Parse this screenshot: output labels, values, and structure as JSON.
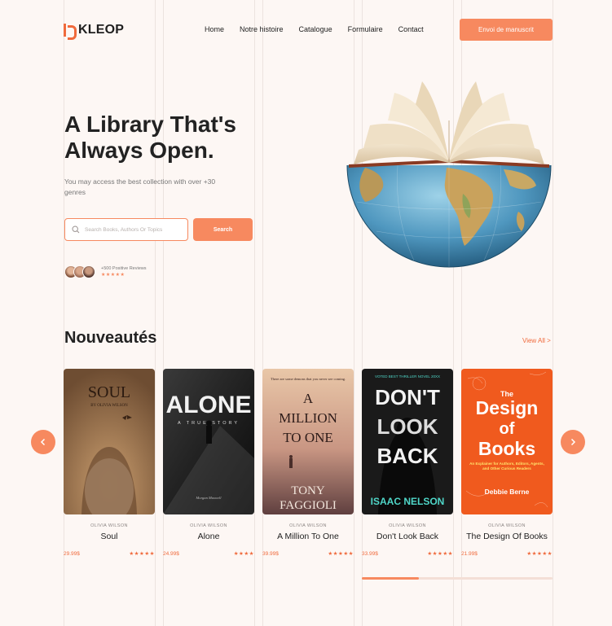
{
  "brand": {
    "name": "KLEOP"
  },
  "nav": {
    "items": [
      "Home",
      "Notre histoire",
      "Catalogue",
      "Formulaire",
      "Contact"
    ]
  },
  "cta": {
    "label": "Envoi de manuscrit"
  },
  "hero": {
    "title": "A Library That's Always Open.",
    "subtitle": "You may access the best collection with over +30 genres",
    "search": {
      "placeholder": "Search Books, Authors Or Topics",
      "button": "Search"
    },
    "reviews": {
      "label": "+500 Positive Reviews",
      "stars": "★★★★★"
    }
  },
  "section": {
    "title": "Nouveautés",
    "view_all": "View All  >"
  },
  "books": [
    {
      "author": "OLIVIA WILSON",
      "title": "Soul",
      "price": "29.99$",
      "stars": "★★★★★",
      "cover": {
        "line1": "SOUL",
        "line2": "BY OLIVIA WILSON"
      }
    },
    {
      "author": "OLIVIA WILSON",
      "title": "Alone",
      "price": "24.99$",
      "stars": "★★★★",
      "cover": {
        "line1": "ALONE",
        "line2": "A TRUE STORY",
        "line3": "Morgan Maxwell"
      }
    },
    {
      "author": "OLIVIA WILSON",
      "title": "A Million To One",
      "price": "39.99$",
      "stars": "★★★★★",
      "cover": {
        "tagline": "There are some demons that you never see coming.",
        "line1": "A",
        "line2": "MILLION",
        "line3": "TO ONE",
        "author1": "TONY",
        "author2": "FAGGIOLI"
      }
    },
    {
      "author": "OLIVIA WILSON",
      "title": "Don't Look Back",
      "price": "33.99$",
      "stars": "★★★★★",
      "cover": {
        "tagline": "VOTED BEST THRILLER NOVEL 20XX",
        "line1": "DON'T",
        "line2": "LOOK",
        "line3": "BACK",
        "author": "ISAAC NELSON"
      }
    },
    {
      "author": "OLIVIA WILSON",
      "title": "The Design Of Books",
      "price": "21.99$",
      "stars": "★★★★★",
      "cover": {
        "line0": "The",
        "line1": "Design",
        "line2": "of",
        "line3": "Books",
        "sub": "An Explainer for Authors, Editors, Agents, and Other Curious Readers",
        "author": "Debbie Berne"
      }
    }
  ],
  "carousel": {
    "progress": 0.3
  },
  "colors": {
    "accent": "#f7895f",
    "background": "#fdf7f4"
  }
}
